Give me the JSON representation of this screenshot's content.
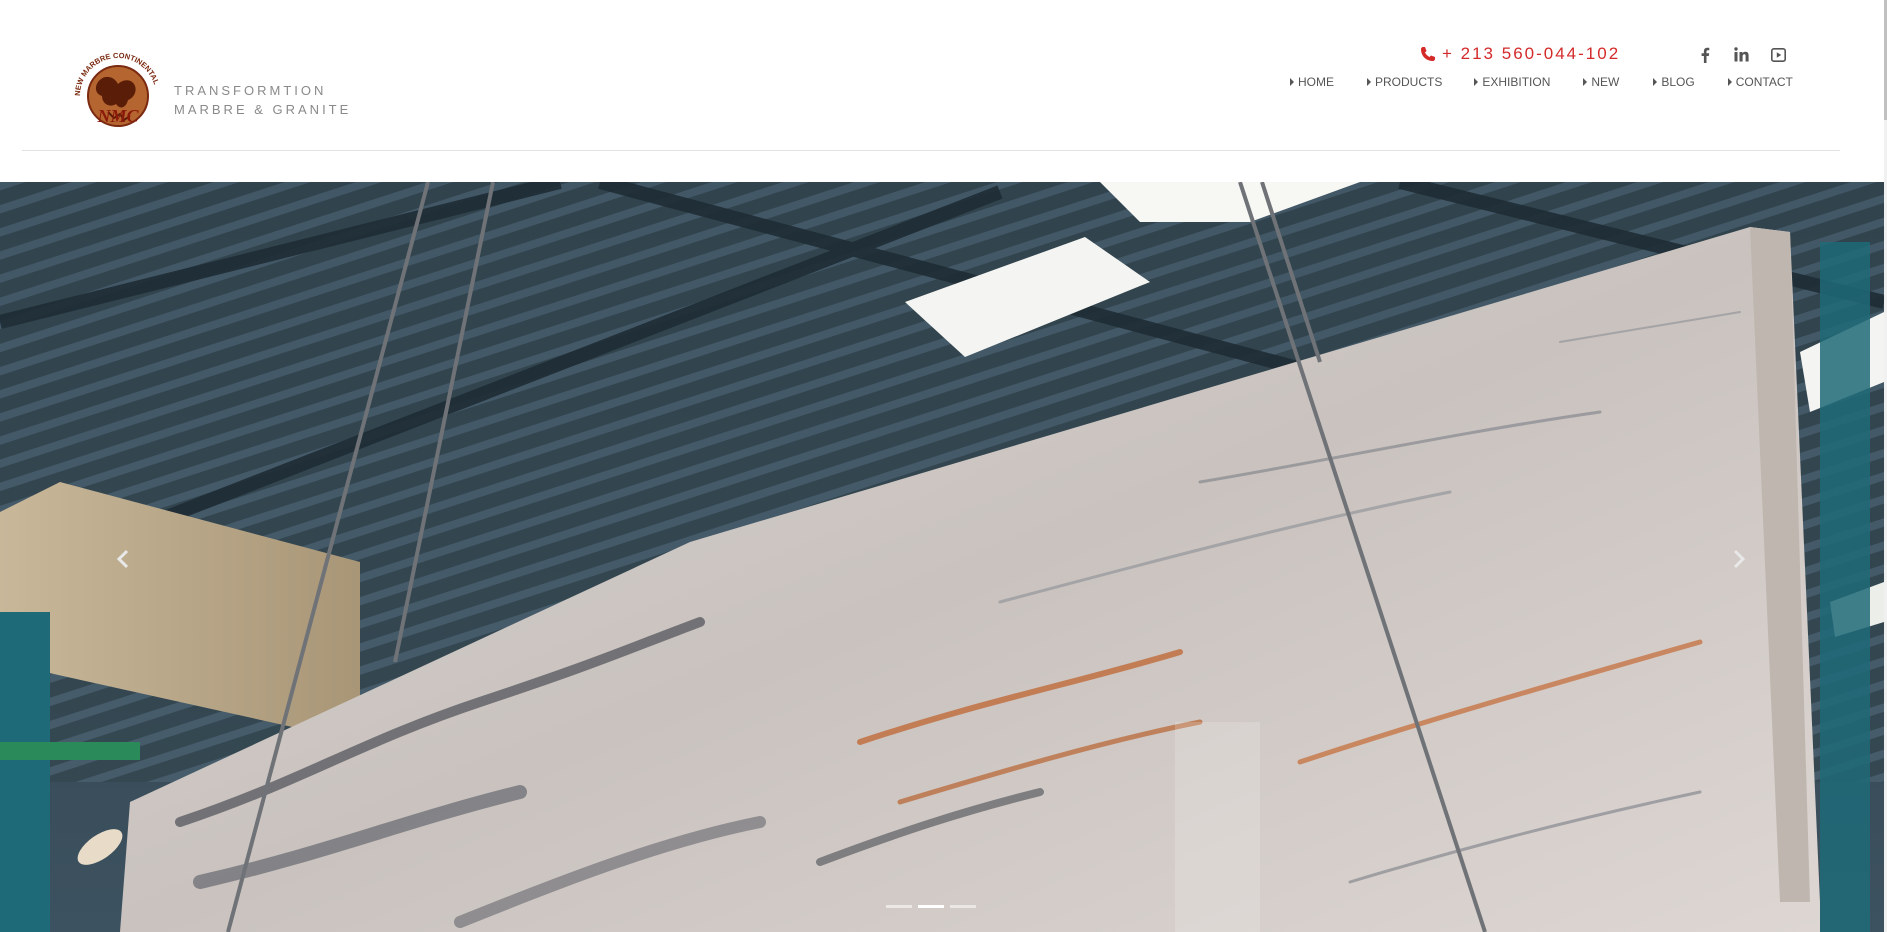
{
  "brand": {
    "logo_ring_text": "NEW MARBRE CONTINENTAL",
    "logo_initials": "NMC",
    "tagline_line1": "TRANSFORMTION",
    "tagline_line2": "MARBRE & GRANITE"
  },
  "contact": {
    "phone": "+ 213 560-044-102",
    "phone_icon": "phone-icon"
  },
  "social": [
    {
      "name": "facebook",
      "icon": "facebook-icon"
    },
    {
      "name": "linkedin",
      "icon": "linkedin-icon"
    },
    {
      "name": "youtube",
      "icon": "youtube-icon"
    }
  ],
  "nav": {
    "items": [
      {
        "label": "HOME"
      },
      {
        "label": "PRODUCTS"
      },
      {
        "label": "EXHIBITION"
      },
      {
        "label": "NEW"
      },
      {
        "label": "BLOG"
      },
      {
        "label": "CONTACT"
      }
    ]
  },
  "slider": {
    "prev_icon": "chevron-left-icon",
    "next_icon": "chevron-right-icon",
    "slide_count": 3,
    "active_slide": 2
  },
  "colors": {
    "accent": "#d42a2a",
    "nav_text": "#555555",
    "tagline": "#8a8a8a",
    "logo_brown": "#7a2a10"
  }
}
